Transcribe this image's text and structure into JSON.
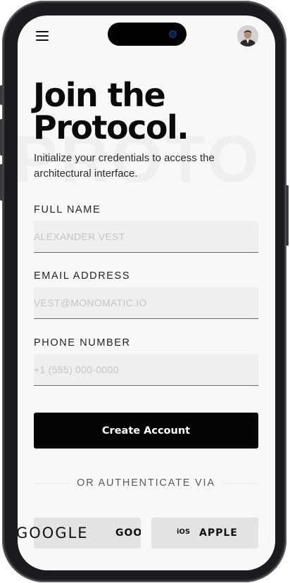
{
  "header": {
    "menu_icon": "hamburger-menu-icon",
    "avatar_icon": "user-avatar"
  },
  "watermark": "PROTO",
  "title": {
    "line1": "Join the",
    "line2": "Protocol."
  },
  "subtitle": "Initialize your credentials to access the architectural interface.",
  "form": {
    "full_name": {
      "label": "FULL NAME",
      "placeholder": "ALEXANDER VEST",
      "value": ""
    },
    "email": {
      "label": "EMAIL ADDRESS",
      "placeholder": "VEST@MONOMATIC.IO",
      "value": ""
    },
    "phone": {
      "label": "PHONE NUMBER",
      "placeholder": "+1 (555) 000-0000",
      "value": ""
    }
  },
  "primary_button": "Create Account",
  "divider_text": "OR AUTHENTICATE VIA",
  "social": {
    "google_logo": "GOOGLE",
    "google_label": "GOOGLE",
    "apple_logo": "iOS",
    "apple_label": "APPLE"
  },
  "colors": {
    "background": "#f8f8f8",
    "primary": "#050505",
    "field_bg": "#efefef",
    "social_bg": "#e3e3e3"
  }
}
